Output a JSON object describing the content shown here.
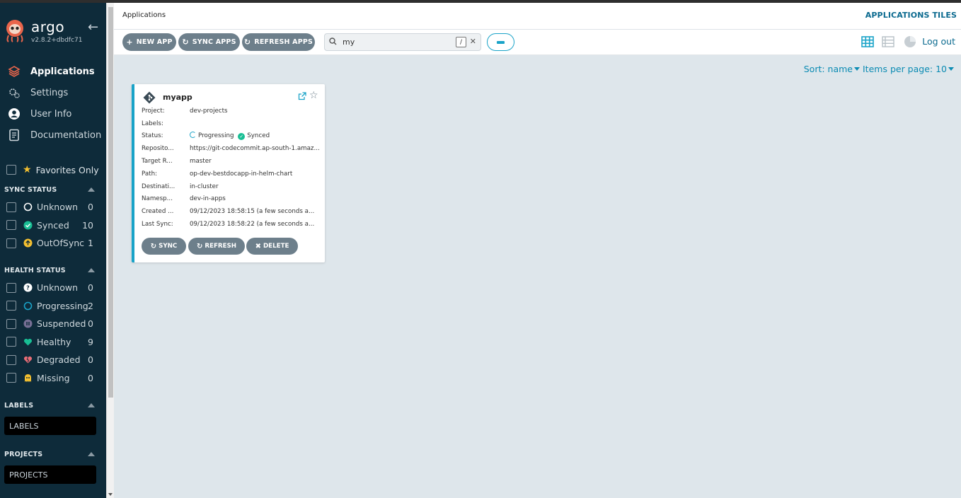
{
  "app": {
    "name": "argo",
    "version": "v2.8.2+dbdfc71"
  },
  "nav": [
    {
      "label": "Applications",
      "icon": "layers-icon"
    },
    {
      "label": "Settings",
      "icon": "gears-icon"
    },
    {
      "label": "User Info",
      "icon": "user-circle-icon"
    },
    {
      "label": "Documentation",
      "icon": "book-icon"
    }
  ],
  "favorites": {
    "label": "Favorites Only"
  },
  "sync_status": {
    "title": "SYNC STATUS",
    "items": [
      {
        "label": "Unknown",
        "count": "0",
        "color": "#ffffff"
      },
      {
        "label": "Synced",
        "count": "10",
        "color": "#18be94"
      },
      {
        "label": "OutOfSync",
        "count": "1",
        "color": "#f4c030"
      }
    ]
  },
  "health_status": {
    "title": "HEALTH STATUS",
    "items": [
      {
        "label": "Unknown",
        "count": "0",
        "color": "#ffffff"
      },
      {
        "label": "Progressing",
        "count": "2",
        "color": "#1aa3c8"
      },
      {
        "label": "Suspended",
        "count": "0",
        "color": "#766f94"
      },
      {
        "label": "Healthy",
        "count": "9",
        "color": "#18be94"
      },
      {
        "label": "Degraded",
        "count": "0",
        "color": "#e96d76"
      },
      {
        "label": "Missing",
        "count": "0",
        "color": "#f4c030"
      }
    ]
  },
  "labels": {
    "title": "LABELS",
    "placeholder": "LABELS"
  },
  "projects": {
    "title": "PROJECTS",
    "placeholder": "PROJECTS"
  },
  "header": {
    "breadcrumb": "Applications",
    "title": "APPLICATIONS TILES"
  },
  "toolbar": {
    "new_app": "NEW APP",
    "sync_apps": "SYNC APPS",
    "refresh_apps": "REFRESH APPS",
    "search_value": "my",
    "search_shortcut": "/",
    "logout": "Log out"
  },
  "sort": {
    "label": "Sort: name",
    "per_page": "Items per page: 10"
  },
  "card": {
    "name": "myapp",
    "rows": [
      {
        "k": "Project:",
        "v": "dev-projects"
      },
      {
        "k": "Labels:",
        "v": ""
      },
      {
        "k": "Status:",
        "v": ""
      },
      {
        "k": "Reposito...",
        "v": "https://git-codecommit.ap-south-1.amaz..."
      },
      {
        "k": "Target R...",
        "v": "master"
      },
      {
        "k": "Path:",
        "v": "op-dev-bestdocapp-in-helm-chart"
      },
      {
        "k": "Destinati...",
        "v": "in-cluster"
      },
      {
        "k": "Namesp...",
        "v": "dev-in-apps"
      },
      {
        "k": "Created ...",
        "v": "09/12/2023 18:58:15  (a few seconds a..."
      },
      {
        "k": "Last Sync:",
        "v": "09/12/2023 18:58:22  (a few seconds a..."
      }
    ],
    "health": "Progressing",
    "sync": "Synced",
    "buttons": {
      "sync": "SYNC",
      "refresh": "REFRESH",
      "delete": "DELETE"
    }
  }
}
